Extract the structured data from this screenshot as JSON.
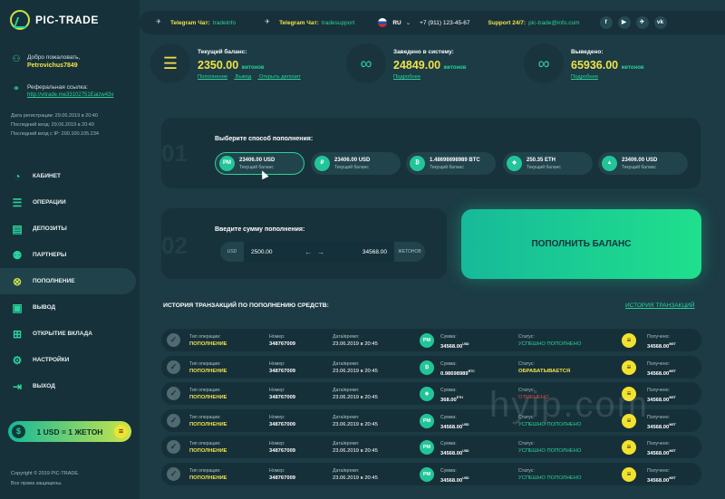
{
  "app": {
    "name": "PIC-TRADE"
  },
  "sidebar": {
    "welcome_label": "Добро пожаловать,",
    "username": "Petrovichus7849",
    "ref_label": "Реферальная ссылка:",
    "ref_link": "http://vitrade.me33102751Eaizw43x",
    "reg_date": "Дата регистрации: 29.06.2019 в 20:40",
    "last_login": "Последний вход: 29.06.2019 в 20:40",
    "last_ip": "Последний вход с IP: 200.100.105.234",
    "menu": [
      {
        "label": "Кабинет",
        "icon": "gauge-icon"
      },
      {
        "label": "Операции",
        "icon": "list-icon"
      },
      {
        "label": "Депозиты",
        "icon": "deposit-icon"
      },
      {
        "label": "Партнеры",
        "icon": "partners-icon"
      },
      {
        "label": "Пополнение",
        "icon": "topup-icon",
        "active": true
      },
      {
        "label": "Вывод",
        "icon": "withdraw-icon"
      },
      {
        "label": "Открытие вклада",
        "icon": "open-deposit-icon"
      },
      {
        "label": "Настройки",
        "icon": "settings-icon"
      },
      {
        "label": "Выход",
        "icon": "logout-icon"
      }
    ],
    "rate_text": "1 USD = 1 ЖЕТОН",
    "copyright": "Copyright © 2019 PIC-TRADE.",
    "rights": "Все права защищены."
  },
  "topbar": {
    "tg_chat_label": "Telegram Чат:",
    "tg_chat_value": "tradeinfo",
    "tg_support_label": "Telegram Чат:",
    "tg_support_value": "tradesupport",
    "lang": "RU",
    "phone": "+7 (911) 123-45-67",
    "support_label": "Support 24/7:",
    "support_value": "pic-trade@info.com",
    "socials": [
      "f",
      "▶",
      "✈",
      "vk"
    ]
  },
  "stats": {
    "balance": {
      "label": "Текущий баланс:",
      "value": "2350.00",
      "unit": "жетонов",
      "links": [
        "Пополнение",
        "Вывод",
        "Открыть депозит"
      ]
    },
    "deposited": {
      "label": "Заведено в систему:",
      "value": "24849.00",
      "unit": "жетонов",
      "link": "Подробнее"
    },
    "withdrawn": {
      "label": "Выведено:",
      "value": "65936.00",
      "unit": "жетонов",
      "link": "Подробнее"
    }
  },
  "step1": {
    "num": "01",
    "title": "Выберите способ пополнения:",
    "methods": [
      {
        "icon": "PM",
        "amount": "23406.00 USD",
        "sub": "Текущий баланс",
        "selected": true
      },
      {
        "icon": "₽",
        "amount": "23406.00 USD",
        "sub": "Текущий баланс"
      },
      {
        "icon": "₿",
        "amount": "1.48698698989 BTC",
        "sub": "Текущий баланс"
      },
      {
        "icon": "◆",
        "amount": "250.35 ETH",
        "sub": "Текущий баланс"
      },
      {
        "icon": "▲",
        "amount": "23406.00 USD",
        "sub": "Текущий баланс"
      }
    ]
  },
  "step2": {
    "num": "02",
    "title": "Введите сумму пополнения:",
    "currency": "USD",
    "amount": "2500.00",
    "tokens": "34568.00",
    "token_label": "ЖЕТОНОВ"
  },
  "submit_label": "ПОПОЛНИТЬ БАЛАНС",
  "history": {
    "title": "ИСТОРИЯ ТРАНЗАКЦИЙ ПО ПОПОЛНЕНИЮ СРЕДСТВ:",
    "link": "ИСТОРИЯ ТРАНЗАКЦИЙ",
    "labels": {
      "type": "Тип операции:",
      "number": "Номер:",
      "date": "Дата/время:",
      "sum": "Сумма:",
      "status": "Статус:",
      "received": "Получено:"
    },
    "rows": [
      {
        "type": "ПОПОЛНЕНИЕ",
        "number": "348767009",
        "date": "23.06.2019 в 20:45",
        "coin": "PM",
        "sum": "34568.00",
        "sum_unit": "USD",
        "status": "УСПЕШНО ПОПОЛНЕНО",
        "status_kind": "ok",
        "received": "34568.00",
        "rec_unit": "ЖЕТ"
      },
      {
        "type": "ПОПОЛНЕНИЕ",
        "number": "348767009",
        "date": "23.06.2019 в 20:45",
        "coin": "₿",
        "sum": "0.98698989",
        "sum_unit": "BTC",
        "status": "ОБРАБАТЫВАЕТСЯ",
        "status_kind": "pending",
        "received": "34568.00",
        "rec_unit": "ЖЕТ"
      },
      {
        "type": "ПОПОЛНЕНИЕ",
        "number": "348767009",
        "date": "23.06.2019 в 20:45",
        "coin": "◆",
        "sum": "368.00",
        "sum_unit": "ETH",
        "status": "ОТМЕНЕНО",
        "status_kind": "cancel",
        "received": "34568.00",
        "rec_unit": "ЖЕТ"
      },
      {
        "type": "ПОПОЛНЕНИЕ",
        "number": "348767009",
        "date": "23.06.2019 в 20:45",
        "coin": "PM",
        "sum": "34568.00",
        "sum_unit": "USD",
        "status": "УСПЕШНО ПОПОЛНЕНО",
        "status_kind": "ok",
        "received": "34568.00",
        "rec_unit": "ЖЕТ"
      },
      {
        "type": "ПОПОЛНЕНИЕ",
        "number": "348767009",
        "date": "23.06.2019 в 20:45",
        "coin": "PM",
        "sum": "34568.00",
        "sum_unit": "USD",
        "status": "УСПЕШНО ПОПОЛНЕНО",
        "status_kind": "ok",
        "received": "34568.00",
        "rec_unit": "ЖЕТ"
      },
      {
        "type": "ПОПОЛНЕНИЕ",
        "number": "348767009",
        "date": "23.06.2019 в 20:45",
        "coin": "PM",
        "sum": "34568.00",
        "sum_unit": "USD",
        "status": "УСПЕШНО ПОПОЛНЕНО",
        "status_kind": "ok",
        "received": "34568.00",
        "rec_unit": "ЖЕТ"
      }
    ]
  },
  "watermark": "hyip.com"
}
